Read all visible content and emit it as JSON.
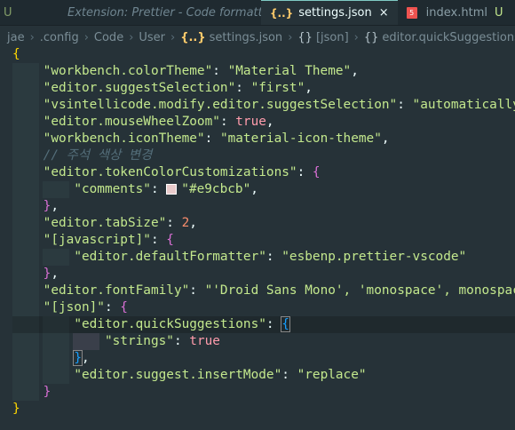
{
  "tabs": [
    {
      "label": "U"
    },
    {
      "label": "Extension: Prettier - Code formatter"
    },
    {
      "icon": "{..}",
      "label": "settings.json",
      "close": "×"
    },
    {
      "label": "index.html",
      "modified": "U"
    }
  ],
  "breadcrumb": {
    "items": [
      "jae",
      ".config",
      "Code",
      "User"
    ],
    "file_icon": "{..}",
    "file": "settings.json",
    "json_node": "[json]",
    "leaf": "editor.quickSuggestions"
  },
  "code": {
    "l1": "{",
    "colorTheme_key": "\"workbench.colorTheme\"",
    "colorTheme_val": "\"Material Theme\"",
    "suggestSel_key": "\"editor.suggestSelection\"",
    "suggestSel_val": "\"first\"",
    "vsi_key": "\"vsintellicode.modify.editor.suggestSelection\"",
    "vsi_val": "\"automaticallyOv",
    "zoom_key": "\"editor.mouseWheelZoom\"",
    "zoom_val": "true",
    "iconTheme_key": "\"workbench.iconTheme\"",
    "iconTheme_val": "\"material-icon-theme\"",
    "comment": "// 주석 색상 변경",
    "tokenColor_key": "\"editor.tokenColorCustomizations\"",
    "comments_key": "\"comments\"",
    "comments_val": "\"#e9cbcb\"",
    "tabSize_key": "\"editor.tabSize\"",
    "tabSize_val": "2",
    "javascript_key": "\"[javascript]\"",
    "formatter_key": "\"editor.defaultFormatter\"",
    "formatter_val": "\"esbenp.prettier-vscode\"",
    "fontFamily_key": "\"editor.fontFamily\"",
    "fontFamily_val": "\"'Droid Sans Mono', 'monospace', monospace",
    "json_key": "\"[json]\"",
    "quick_key": "\"editor.quickSuggestions\"",
    "strings_key": "\"strings\"",
    "strings_val": "true",
    "insertMode_key": "\"editor.suggest.insertMode\"",
    "insertMode_val": "\"replace\""
  },
  "colors": {
    "background": "#263238",
    "string": "#c3e88d",
    "number": "#f78c6c",
    "bracket_gold": "#ffd700",
    "bracket_orchid": "#da70d6",
    "bracket_blue": "#179fff",
    "swatch": "#e9cbcb"
  }
}
